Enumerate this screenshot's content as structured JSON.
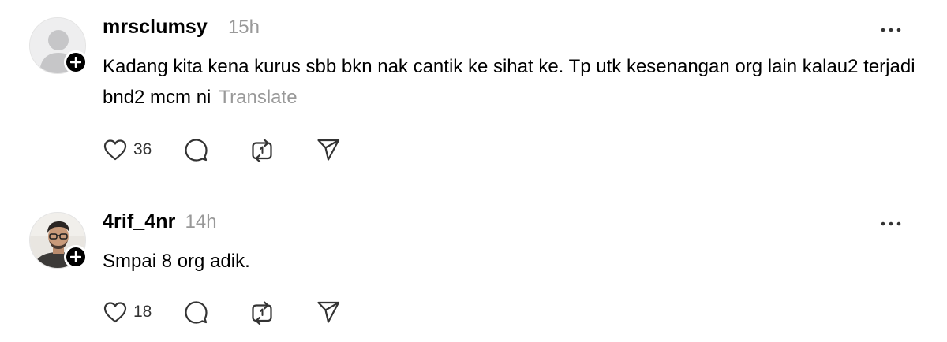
{
  "posts": [
    {
      "username": "mrsclumsy_",
      "time": "15h",
      "text": "Kadang kita kena kurus sbb bkn nak cantik ke sihat ke. Tp utk kesenangan org lain kalau2 terjadi bnd2 mcm ni",
      "translate_label": "Translate",
      "likes": "36",
      "avatar_icon": "default-avatar-icon"
    },
    {
      "username": "4rif_4nr",
      "time": "14h",
      "text": "Smpai 8 org adik.",
      "likes": "18",
      "avatar_icon": "profile-photo"
    }
  ],
  "icons": {
    "like": "heart-icon",
    "reply": "speech-bubble-icon",
    "repost": "repost-icon",
    "share": "send-icon",
    "more": "more-dots-icon",
    "follow": "plus-icon"
  },
  "colors": {
    "text": "#000000",
    "muted": "#999999",
    "divider": "#dbdbdb",
    "icon": "#333333"
  }
}
